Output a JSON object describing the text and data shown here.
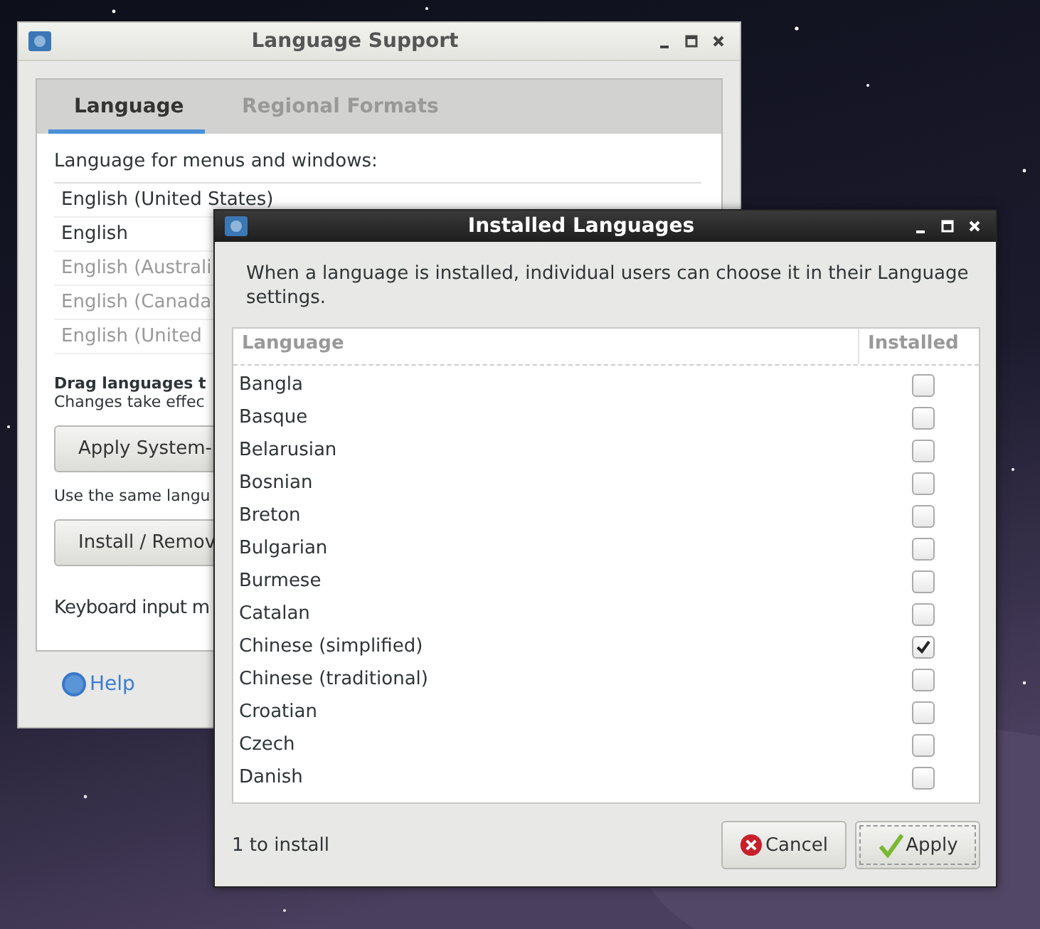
{
  "language_support": {
    "title": "Language Support",
    "tabs": [
      {
        "label": "Language",
        "selected": true
      },
      {
        "label": "Regional Formats",
        "selected": false
      }
    ],
    "list_label": "Language for menus and windows:",
    "languages": [
      {
        "name": "English (United States)",
        "disabled": false
      },
      {
        "name": "English",
        "disabled": false
      },
      {
        "name": "English (Australi",
        "disabled": true
      },
      {
        "name": "English (Canada",
        "disabled": true
      },
      {
        "name": "English (United",
        "disabled": true
      }
    ],
    "drag_hint": "Drag languages t",
    "changes_note": "Changes take effec",
    "apply_button": "Apply System-",
    "same_language_note": "Use the same langu",
    "install_button": "Install / Remov",
    "keyboard_label": "Keyboard input m",
    "help_link": "Help"
  },
  "installed_languages": {
    "title": "Installed Languages",
    "description": "When a language is installed, individual users can choose it in their Language settings.",
    "columns": [
      "Language",
      "Installed"
    ],
    "rows": [
      {
        "name": "Bangla",
        "checked": false
      },
      {
        "name": "Basque",
        "checked": false
      },
      {
        "name": "Belarusian",
        "checked": false
      },
      {
        "name": "Bosnian",
        "checked": false
      },
      {
        "name": "Breton",
        "checked": false
      },
      {
        "name": "Bulgarian",
        "checked": false
      },
      {
        "name": "Burmese",
        "checked": false
      },
      {
        "name": "Catalan",
        "checked": false
      },
      {
        "name": "Chinese (simplified)",
        "checked": true
      },
      {
        "name": "Chinese (traditional)",
        "checked": false
      },
      {
        "name": "Croatian",
        "checked": false
      },
      {
        "name": "Czech",
        "checked": false
      },
      {
        "name": "Danish",
        "checked": false
      }
    ],
    "status": "1 to install",
    "buttons": [
      {
        "kind": "cancel",
        "label": "Cancel"
      },
      {
        "kind": "apply",
        "label": "Apply"
      }
    ]
  }
}
